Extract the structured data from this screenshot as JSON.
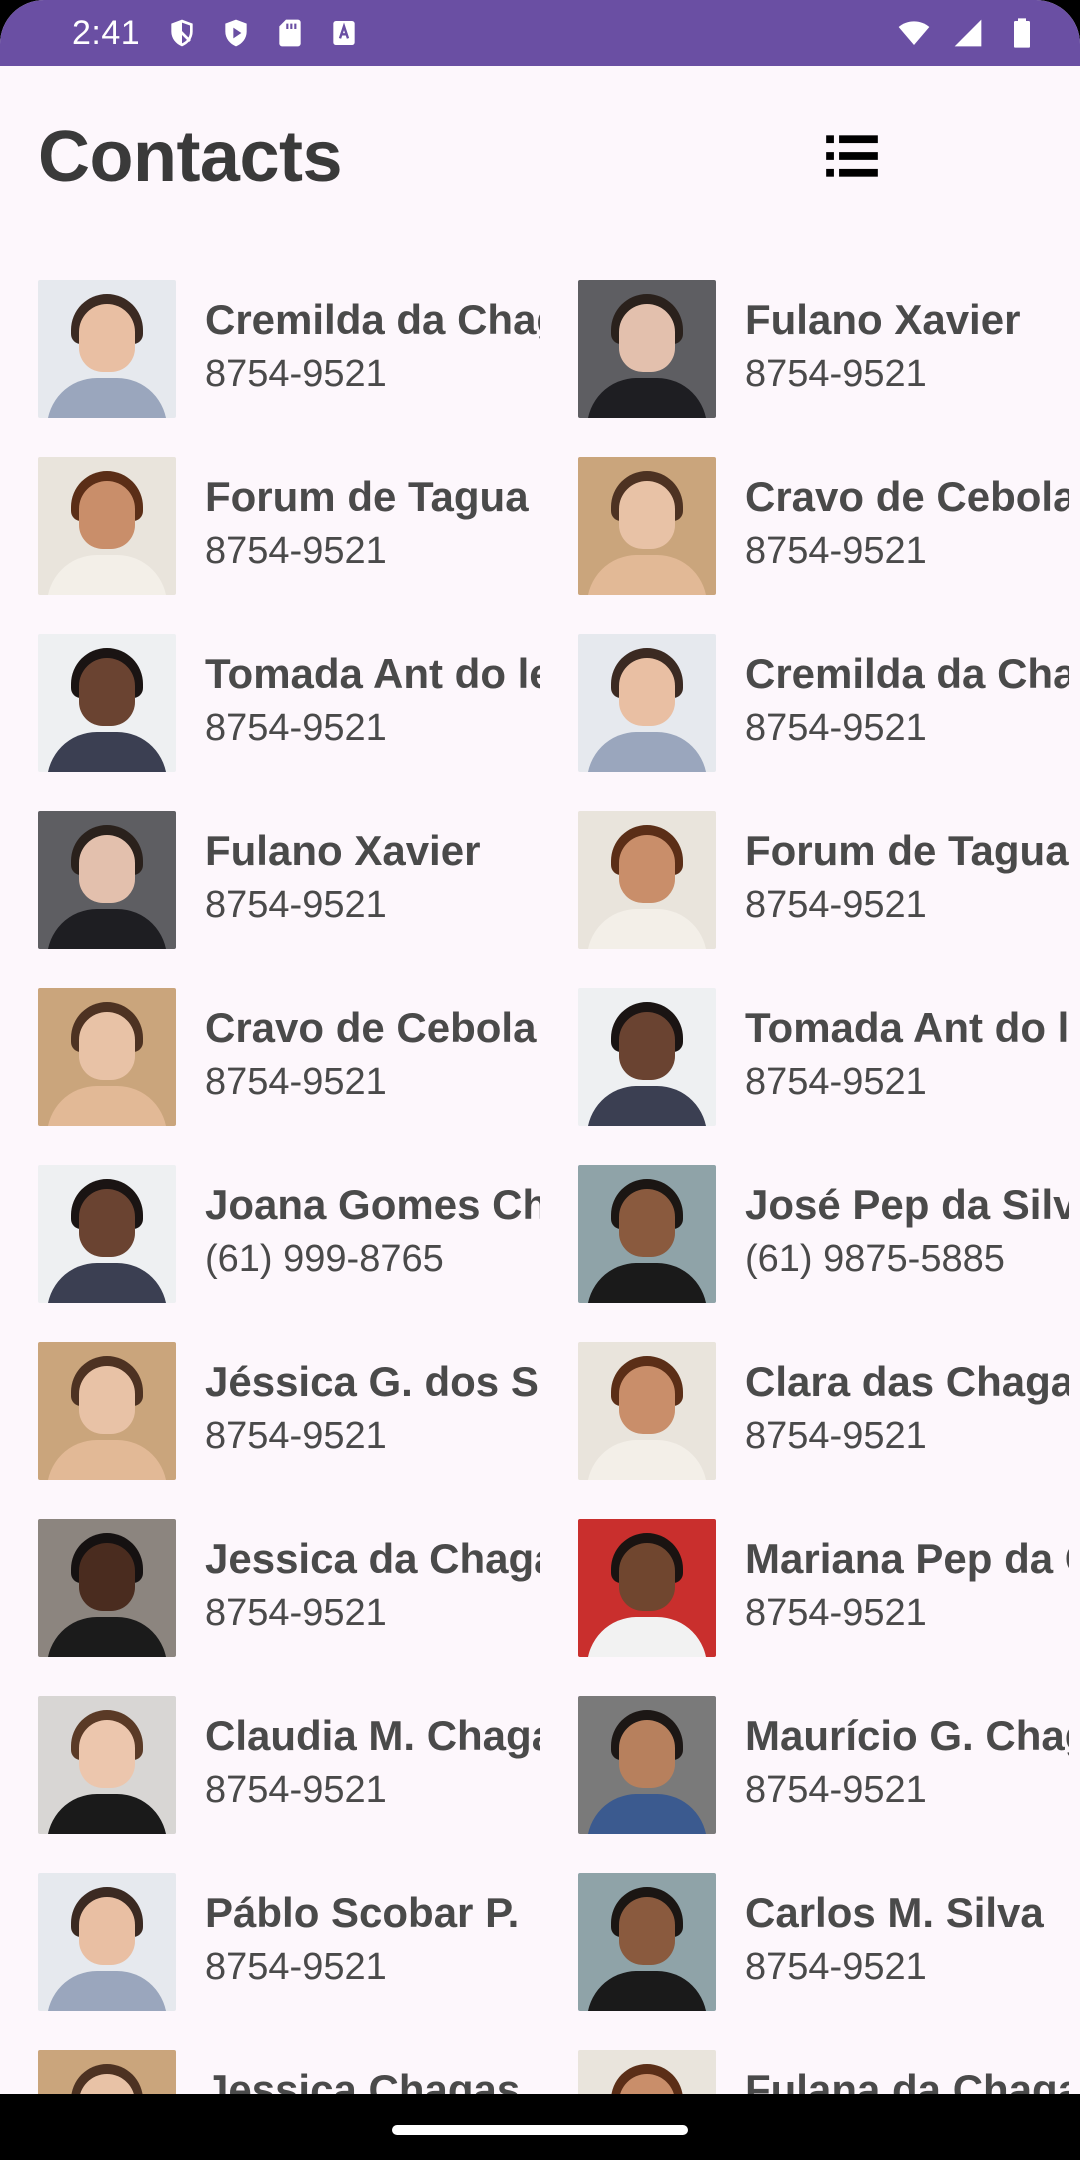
{
  "status_bar": {
    "time": "2:41",
    "left_icons": [
      "shield-icon",
      "play-protect-icon",
      "sd-card-icon",
      "keyboard-a-icon"
    ],
    "right_icons": [
      "wifi-icon",
      "signal-icon",
      "battery-icon"
    ]
  },
  "header": {
    "title": "Contacts",
    "list_view_icon": "list-view-icon",
    "grid_view_icon": "grid-view-icon"
  },
  "contacts": [
    {
      "name": "Cremilda da Chagas",
      "phone": "8754-9521",
      "avatar": "young-man-freckles"
    },
    {
      "name": "Fulano Xavier",
      "phone": "8754-9521",
      "avatar": "woman-grey-bg"
    },
    {
      "name": "Forum de Tagua",
      "phone": "8754-9521",
      "avatar": "woman-short-hair"
    },
    {
      "name": "Cravo de Cebola",
      "phone": "8754-9521",
      "avatar": "woman-long-hair"
    },
    {
      "name": "Tomada Ant do leste",
      "phone": "8754-9521",
      "avatar": "woman-braids-glasses"
    },
    {
      "name": "Cremilda da Chagas",
      "phone": "8754-9521",
      "avatar": "young-man-freckles"
    },
    {
      "name": "Fulano Xavier",
      "phone": "8754-9521",
      "avatar": "woman-grey-bg"
    },
    {
      "name": "Forum de Tagua",
      "phone": "8754-9521",
      "avatar": "woman-short-hair"
    },
    {
      "name": "Cravo de Cebola",
      "phone": "8754-9521",
      "avatar": "woman-long-hair"
    },
    {
      "name": "Tomada Ant do leste",
      "phone": "8754-9521",
      "avatar": "woman-braids-glasses"
    },
    {
      "name": "Joana Gomes Chagas",
      "phone": "(61) 999-8765",
      "avatar": "woman-braids-glasses"
    },
    {
      "name": "José Pep da Silva",
      "phone": "(61) 9875-5885",
      "avatar": "man-braids"
    },
    {
      "name": "Jéssica G. dos Santos",
      "phone": "8754-9521",
      "avatar": "woman-long-hair"
    },
    {
      "name": "Clara das Chagas",
      "phone": "8754-9521",
      "avatar": "woman-short-hair"
    },
    {
      "name": "Jessica da Chagas",
      "phone": "8754-9521",
      "avatar": "woman-afro"
    },
    {
      "name": "Mariana Pep da Chagas",
      "phone": "8754-9521",
      "avatar": "woman-afro-red"
    },
    {
      "name": "Claudia M. Chagas",
      "phone": "8754-9521",
      "avatar": "woman-turtleneck"
    },
    {
      "name": "Maurício G. Chagas",
      "phone": "8754-9521",
      "avatar": "man-smiling"
    },
    {
      "name": "Páblo Scobar P.",
      "phone": "8754-9521",
      "avatar": "young-man-freckles"
    },
    {
      "name": "Carlos M. Silva",
      "phone": "8754-9521",
      "avatar": "man-braids"
    },
    {
      "name": "Jessica Chagas",
      "phone": "",
      "avatar": "woman-long-hair"
    },
    {
      "name": "Fulana da Chagas",
      "phone": "",
      "avatar": "woman-short-hair"
    }
  ],
  "avatars": {
    "young-man-freckles": {
      "bg": "#e6e9ee",
      "skin": "#e9bfa3",
      "hair": "#3b2a22",
      "body": "#9aa6bd"
    },
    "woman-grey-bg": {
      "bg": "#5e5e62",
      "skin": "#e3c0ad",
      "hair": "#2a211c",
      "body": "#1e1e22"
    },
    "woman-short-hair": {
      "bg": "#e9e4dc",
      "skin": "#c98e6a",
      "hair": "#5b2e17",
      "body": "#f3efe8"
    },
    "woman-long-hair": {
      "bg": "#caa57c",
      "skin": "#e8c2a6",
      "hair": "#4d3222",
      "body": "#e2b996"
    },
    "woman-braids-glasses": {
      "bg": "#eef0f2",
      "skin": "#6a4331",
      "hair": "#1a1413",
      "body": "#3b3f52"
    },
    "man-braids": {
      "bg": "#8fa3a8",
      "skin": "#8a5a3e",
      "hair": "#1b1613",
      "body": "#1a1a1a"
    },
    "woman-afro": {
      "bg": "#8c857f",
      "skin": "#4a2c1f",
      "hair": "#151111",
      "body": "#1b1b1b"
    },
    "woman-afro-red": {
      "bg": "#c92f2d",
      "skin": "#70462f",
      "hair": "#1a1311",
      "body": "#f2f2f2"
    },
    "woman-turtleneck": {
      "bg": "#d8d6d4",
      "skin": "#ecc6ad",
      "hair": "#5a3a26",
      "body": "#1a1a1a"
    },
    "man-smiling": {
      "bg": "#7a7a7a",
      "skin": "#b7805d",
      "hair": "#1c1715",
      "body": "#3b5a8f"
    }
  }
}
